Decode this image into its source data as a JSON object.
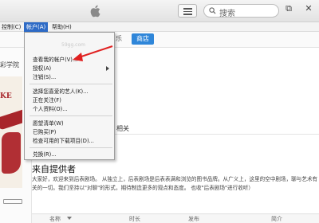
{
  "toolbar": {
    "search_placeholder": "搜索",
    "icons": [
      "apple-logo-icon",
      "list-view-icon",
      "search-icon",
      "window-restore-icon",
      "window-close-icon"
    ],
    "win_restore_glyph": "⧉",
    "win_close_glyph": "✕"
  },
  "menubar": {
    "control": "控制(C)",
    "account": "帐户(A)",
    "help": "帮助(H)"
  },
  "tabs": {
    "partial": "乐",
    "store": "商店"
  },
  "sidebar": {
    "partial_label": "彩学院",
    "poster_text": "KE"
  },
  "account_menu": {
    "watermark": "59gg.com",
    "items": [
      {
        "label": "查看我的帐户(V)...",
        "submenu": false
      },
      {
        "label": "授权(A)",
        "submenu": true
      },
      {
        "label": "注销(S)...",
        "submenu": false
      },
      {
        "label": "选择您喜爱的艺人(K)...",
        "submenu": false
      },
      {
        "label": "正在关注(F)",
        "submenu": false
      },
      {
        "label": "个人资料(O)...",
        "submenu": false
      },
      {
        "label": "愿望清单(W)",
        "submenu": false
      },
      {
        "label": "已购买(P)",
        "submenu": false
      },
      {
        "label": "检查可用的下载项目(D)...",
        "submenu": false
      },
      {
        "label": "兑换(R)...",
        "submenu": false
      }
    ]
  },
  "content": {
    "related": "相关",
    "heading": "来自提供者",
    "description": "大家好，欢迎来到后表剧场。 从独立上，后表剧场是后表表满和浏览的图书品牌。从广义上，这里的空中剧场，聊与艺术有关的一切。我们坚持以\"对聊\"的形式，期待制造更多的观点和态度。 也收\"后表剧场\"进行收听）",
    "table_columns": [
      "名称",
      "时长",
      "发布",
      "简介"
    ]
  },
  "colors": {
    "accent": "#2f86d9",
    "menu_highlight": "#2e6bc6",
    "arrow": "#e02020",
    "poster_red": "#a8252a"
  }
}
